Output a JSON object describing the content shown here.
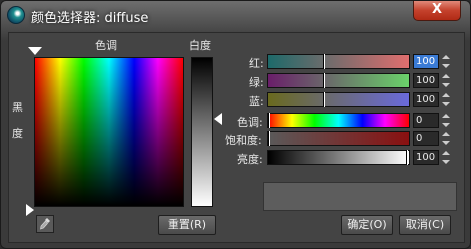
{
  "window": {
    "title": "颜色选择器: diffuse",
    "close_symbol": "X"
  },
  "picker": {
    "hue_label": "色调",
    "whiteness_label": "白度",
    "blackness_label_1": "黑",
    "blackness_label_2": "度",
    "reset_label": "重置(R)"
  },
  "rgb": {
    "red_label": "红:",
    "red_value": "100",
    "green_label": "绿:",
    "green_value": "100",
    "blue_label": "蓝:",
    "blue_value": "100"
  },
  "hsv": {
    "hue_label": "色调:",
    "hue_value": "0",
    "sat_label": "饱和度:",
    "sat_value": "0",
    "val_label": "亮度:",
    "val_value": "100"
  },
  "buttons": {
    "ok": "确定(O)",
    "cancel": "取消(C)"
  },
  "colors": {
    "preview": "#5d5d5d",
    "selected_field": "#3a7bd5"
  },
  "icons": [
    "app-icon",
    "close-icon",
    "eyedropper-icon"
  ]
}
